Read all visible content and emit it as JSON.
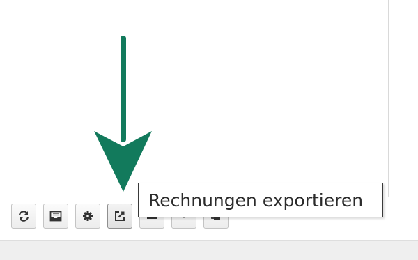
{
  "tooltip": {
    "text": "Rechnungen exportieren"
  },
  "toolbar": {
    "buttons": [
      {
        "icon": "refresh-icon"
      },
      {
        "icon": "inbox-icon"
      },
      {
        "icon": "gear-icon"
      },
      {
        "icon": "external-link-icon"
      },
      {
        "icon": "print-icon"
      },
      {
        "icon": "dropdown-icon"
      },
      {
        "icon": "copy-icon"
      }
    ]
  },
  "colors": {
    "arrow": "#127a5c",
    "icon": "#333333"
  }
}
